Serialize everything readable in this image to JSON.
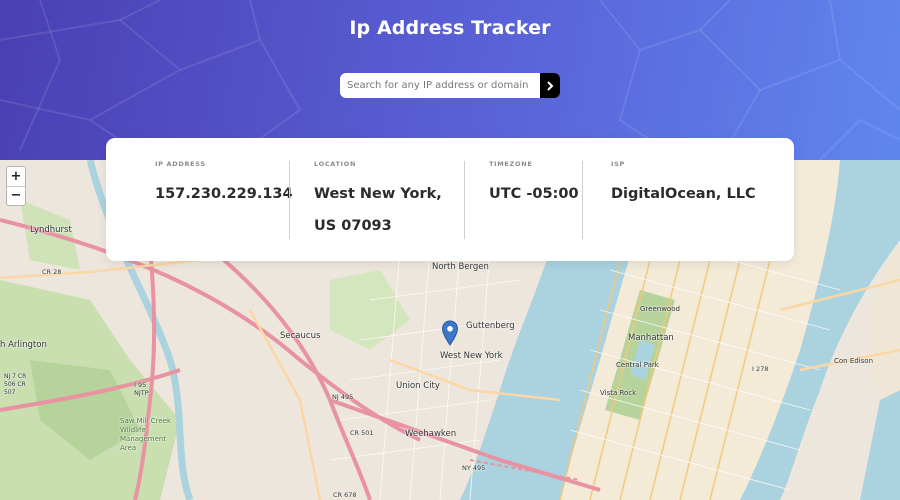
{
  "header": {
    "title": "Ip Address Tracker",
    "search_placeholder": "Search for any IP address or domain",
    "search_value": "",
    "search_button_icon": "chevron-right-icon",
    "gradient_start": "#4a3fb3",
    "gradient_end": "#5f86ee"
  },
  "info": {
    "ip": {
      "label": "IP ADDRESS",
      "value": "157.230.229.134"
    },
    "location": {
      "label": "LOCATION",
      "value": "West New York, US 07093"
    },
    "timezone": {
      "label": "TIMEZONE",
      "value": "UTC -05:00"
    },
    "isp": {
      "label": "ISP",
      "value": "DigitalOcean, LLC"
    }
  },
  "map": {
    "zoom_in_label": "+",
    "zoom_out_label": "−",
    "marker_icon": "map-pin-icon",
    "marker_color": "#3b78c8",
    "labels": {
      "lyndhurst": "Lyndhurst",
      "north_bergen": "North Bergen",
      "guttenberg": "Guttenberg",
      "west_new_york": "West New York",
      "secaucus": "Secaucus",
      "union_city": "Union City",
      "weehawken": "Weehawken",
      "manhattan": "Manhattan",
      "central_park": "Central Park",
      "greenwood": "Greenwood",
      "vista_rock": "Vista Rock",
      "arlington": "h Arlington",
      "sawmill": "Saw Mill Creek Wildlife Management Area",
      "con_edison": "Con Edison",
      "cr28": "CR 28",
      "cr501": "CR 501",
      "cr678": "CR 678",
      "nj495": "NJ 495",
      "ny495": "NY 495",
      "i95": "I 95 NJTP",
      "i278": "I 278",
      "nj7": "NJ 7 CR 506 CR 507"
    }
  }
}
